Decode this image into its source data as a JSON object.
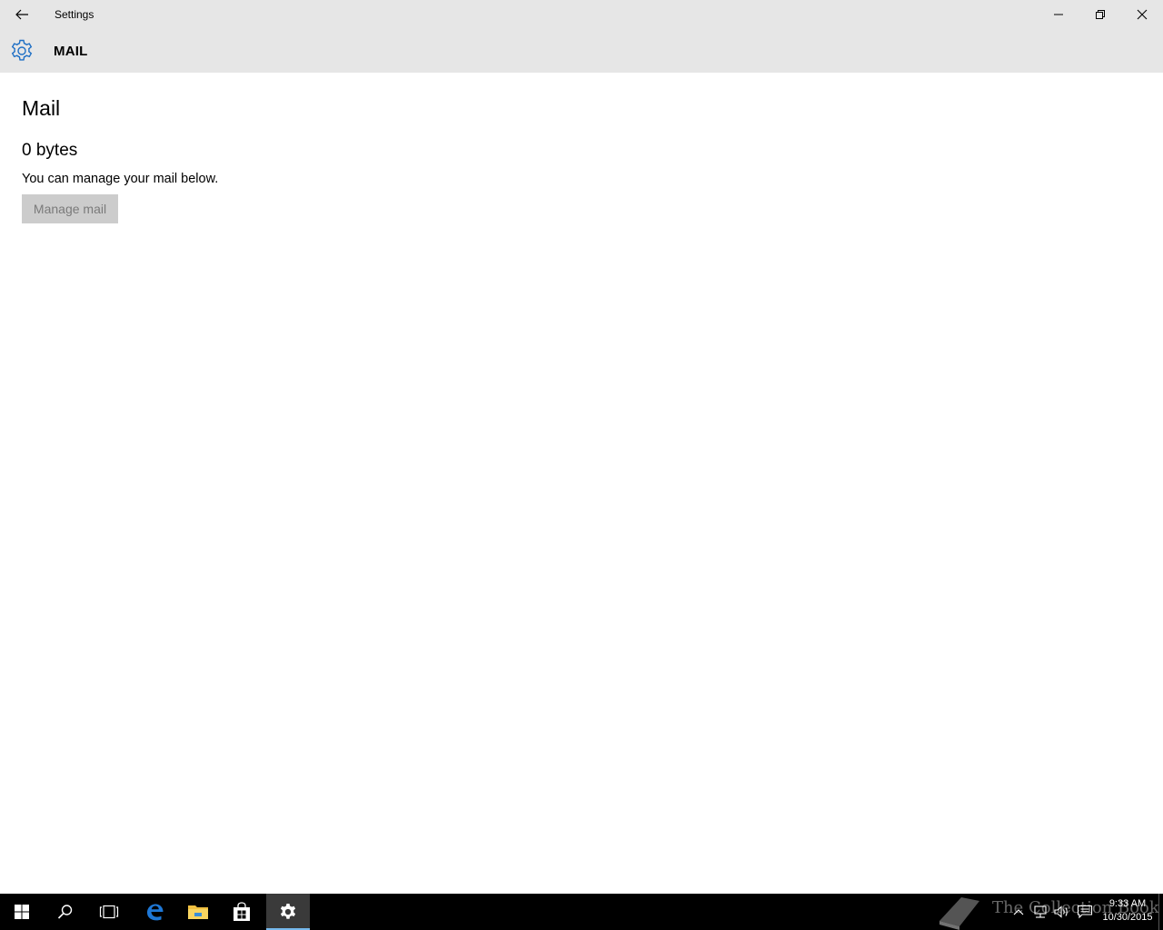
{
  "window": {
    "title": "Settings"
  },
  "header": {
    "title": "MAIL",
    "icon": "gear-icon"
  },
  "content": {
    "page_title": "Mail",
    "storage_size": "0 bytes",
    "description": "You can manage your mail below.",
    "manage_button_label": "Manage mail"
  },
  "taskbar": {
    "apps": [
      "start",
      "search",
      "task-view",
      "edge",
      "file-explorer",
      "store",
      "settings"
    ],
    "active_app": "settings",
    "watermark": "The Collection Book",
    "clock": {
      "time": "9:33 AM",
      "date": "10/30/2015"
    }
  },
  "colors": {
    "titlebar_bg": "#e6e6e6",
    "accent": "#1e6fc5",
    "taskbar_bg": "#000000",
    "button_disabled_bg": "#cccccc"
  }
}
